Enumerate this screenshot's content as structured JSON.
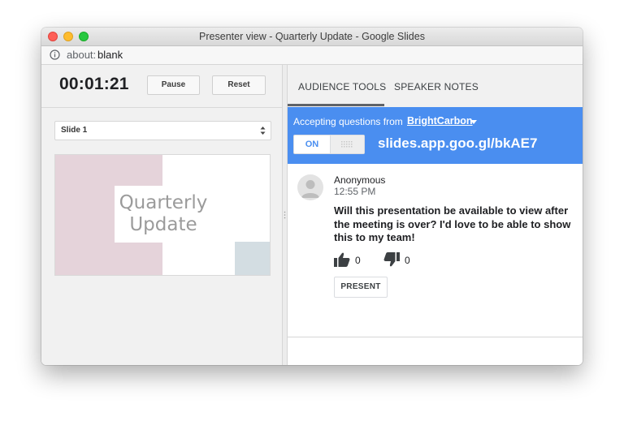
{
  "window": {
    "title": "Presenter view - Quarterly Update - Google Slides",
    "address_scheme": "about:",
    "address_host": "blank"
  },
  "timer": {
    "elapsed": "00:01:21",
    "pause_label": "Pause",
    "reset_label": "Reset"
  },
  "slides": {
    "selected": "Slide 1",
    "thumbnail_title_line1": "Quarterly",
    "thumbnail_title_line2": "Update"
  },
  "tabs": [
    {
      "label": "AUDIENCE TOOLS",
      "active": true
    },
    {
      "label": "SPEAKER NOTES",
      "active": false
    }
  ],
  "qa": {
    "accepting_text": "Accepting questions from",
    "account": "BrightCarbon",
    "toggle_on_label": "ON",
    "short_url": "slides.app.goo.gl/bkAE7",
    "accent_color": "#4a8ef0"
  },
  "question": {
    "author": "Anonymous",
    "time": "12:55 PM",
    "text": "Will this presentation be available to view after the meeting is over? I'd love to be able to show this to my team!",
    "upvotes": "0",
    "downvotes": "0",
    "present_label": "PRESENT"
  }
}
